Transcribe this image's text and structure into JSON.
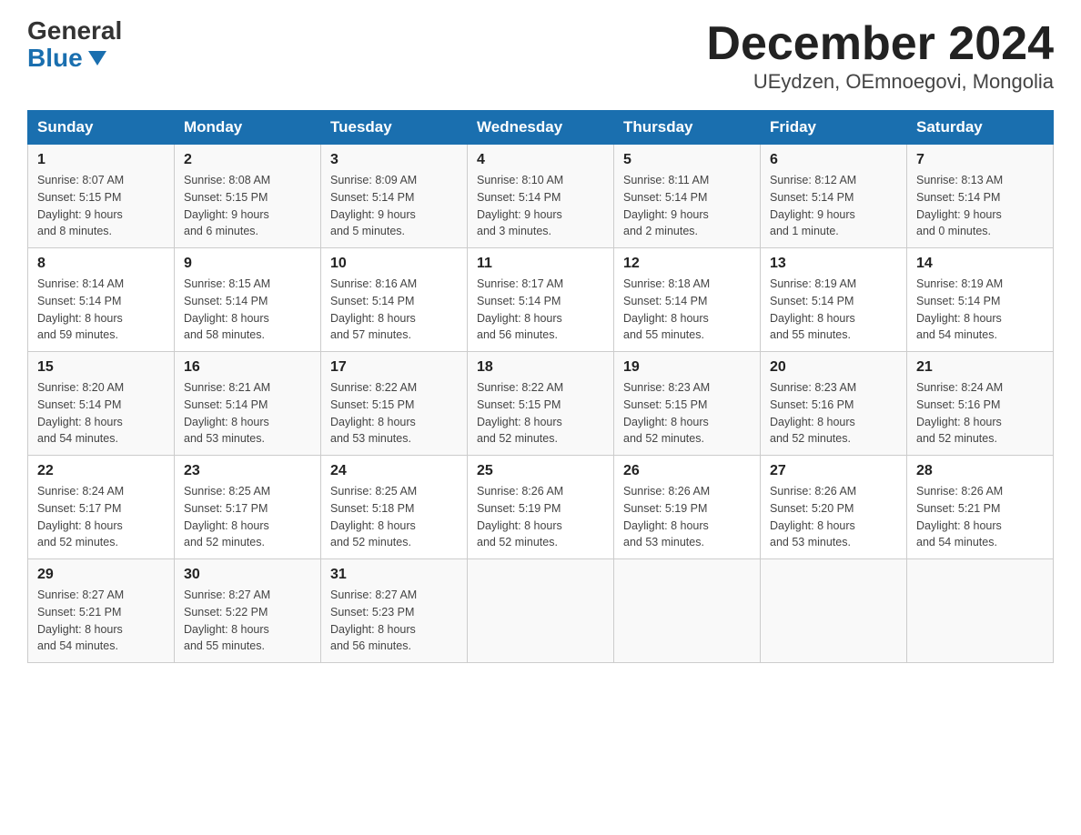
{
  "logo": {
    "general": "General",
    "blue": "Blue"
  },
  "header": {
    "month_title": "December 2024",
    "subtitle": "UEydzen, OEmnoegovi, Mongolia"
  },
  "weekdays": [
    "Sunday",
    "Monday",
    "Tuesday",
    "Wednesday",
    "Thursday",
    "Friday",
    "Saturday"
  ],
  "weeks": [
    [
      {
        "day": "1",
        "sunrise": "8:07 AM",
        "sunset": "5:15 PM",
        "daylight": "9 hours and 8 minutes."
      },
      {
        "day": "2",
        "sunrise": "8:08 AM",
        "sunset": "5:15 PM",
        "daylight": "9 hours and 6 minutes."
      },
      {
        "day": "3",
        "sunrise": "8:09 AM",
        "sunset": "5:14 PM",
        "daylight": "9 hours and 5 minutes."
      },
      {
        "day": "4",
        "sunrise": "8:10 AM",
        "sunset": "5:14 PM",
        "daylight": "9 hours and 3 minutes."
      },
      {
        "day": "5",
        "sunrise": "8:11 AM",
        "sunset": "5:14 PM",
        "daylight": "9 hours and 2 minutes."
      },
      {
        "day": "6",
        "sunrise": "8:12 AM",
        "sunset": "5:14 PM",
        "daylight": "9 hours and 1 minute."
      },
      {
        "day": "7",
        "sunrise": "8:13 AM",
        "sunset": "5:14 PM",
        "daylight": "9 hours and 0 minutes."
      }
    ],
    [
      {
        "day": "8",
        "sunrise": "8:14 AM",
        "sunset": "5:14 PM",
        "daylight": "8 hours and 59 minutes."
      },
      {
        "day": "9",
        "sunrise": "8:15 AM",
        "sunset": "5:14 PM",
        "daylight": "8 hours and 58 minutes."
      },
      {
        "day": "10",
        "sunrise": "8:16 AM",
        "sunset": "5:14 PM",
        "daylight": "8 hours and 57 minutes."
      },
      {
        "day": "11",
        "sunrise": "8:17 AM",
        "sunset": "5:14 PM",
        "daylight": "8 hours and 56 minutes."
      },
      {
        "day": "12",
        "sunrise": "8:18 AM",
        "sunset": "5:14 PM",
        "daylight": "8 hours and 55 minutes."
      },
      {
        "day": "13",
        "sunrise": "8:19 AM",
        "sunset": "5:14 PM",
        "daylight": "8 hours and 55 minutes."
      },
      {
        "day": "14",
        "sunrise": "8:19 AM",
        "sunset": "5:14 PM",
        "daylight": "8 hours and 54 minutes."
      }
    ],
    [
      {
        "day": "15",
        "sunrise": "8:20 AM",
        "sunset": "5:14 PM",
        "daylight": "8 hours and 54 minutes."
      },
      {
        "day": "16",
        "sunrise": "8:21 AM",
        "sunset": "5:14 PM",
        "daylight": "8 hours and 53 minutes."
      },
      {
        "day": "17",
        "sunrise": "8:22 AM",
        "sunset": "5:15 PM",
        "daylight": "8 hours and 53 minutes."
      },
      {
        "day": "18",
        "sunrise": "8:22 AM",
        "sunset": "5:15 PM",
        "daylight": "8 hours and 52 minutes."
      },
      {
        "day": "19",
        "sunrise": "8:23 AM",
        "sunset": "5:15 PM",
        "daylight": "8 hours and 52 minutes."
      },
      {
        "day": "20",
        "sunrise": "8:23 AM",
        "sunset": "5:16 PM",
        "daylight": "8 hours and 52 minutes."
      },
      {
        "day": "21",
        "sunrise": "8:24 AM",
        "sunset": "5:16 PM",
        "daylight": "8 hours and 52 minutes."
      }
    ],
    [
      {
        "day": "22",
        "sunrise": "8:24 AM",
        "sunset": "5:17 PM",
        "daylight": "8 hours and 52 minutes."
      },
      {
        "day": "23",
        "sunrise": "8:25 AM",
        "sunset": "5:17 PM",
        "daylight": "8 hours and 52 minutes."
      },
      {
        "day": "24",
        "sunrise": "8:25 AM",
        "sunset": "5:18 PM",
        "daylight": "8 hours and 52 minutes."
      },
      {
        "day": "25",
        "sunrise": "8:26 AM",
        "sunset": "5:19 PM",
        "daylight": "8 hours and 52 minutes."
      },
      {
        "day": "26",
        "sunrise": "8:26 AM",
        "sunset": "5:19 PM",
        "daylight": "8 hours and 53 minutes."
      },
      {
        "day": "27",
        "sunrise": "8:26 AM",
        "sunset": "5:20 PM",
        "daylight": "8 hours and 53 minutes."
      },
      {
        "day": "28",
        "sunrise": "8:26 AM",
        "sunset": "5:21 PM",
        "daylight": "8 hours and 54 minutes."
      }
    ],
    [
      {
        "day": "29",
        "sunrise": "8:27 AM",
        "sunset": "5:21 PM",
        "daylight": "8 hours and 54 minutes."
      },
      {
        "day": "30",
        "sunrise": "8:27 AM",
        "sunset": "5:22 PM",
        "daylight": "8 hours and 55 minutes."
      },
      {
        "day": "31",
        "sunrise": "8:27 AM",
        "sunset": "5:23 PM",
        "daylight": "8 hours and 56 minutes."
      },
      null,
      null,
      null,
      null
    ]
  ],
  "labels": {
    "sunrise": "Sunrise:",
    "sunset": "Sunset:",
    "daylight": "Daylight:"
  }
}
